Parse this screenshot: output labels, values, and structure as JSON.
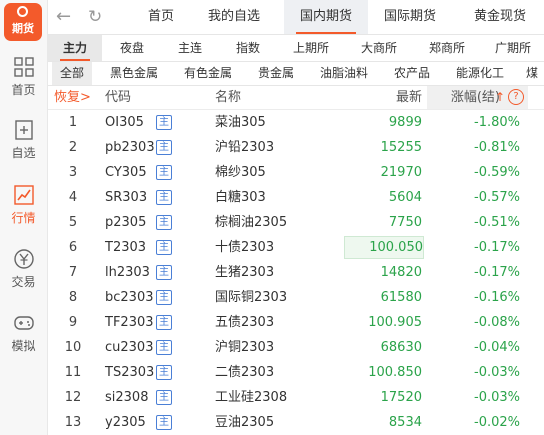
{
  "app": {
    "logo_text": "期货"
  },
  "sidebar": {
    "items": [
      {
        "label": "首页",
        "icon": "grid-icon",
        "active": false
      },
      {
        "label": "自选",
        "icon": "plus-square-icon",
        "active": false
      },
      {
        "label": "行情",
        "icon": "chart-icon",
        "active": true
      },
      {
        "label": "交易",
        "icon": "yen-icon",
        "active": false
      },
      {
        "label": "模拟",
        "icon": "gamepad-icon",
        "active": false
      }
    ]
  },
  "topnav": {
    "tabs": [
      {
        "label": "首页"
      },
      {
        "label": "我的自选"
      },
      {
        "label": "国内期货"
      },
      {
        "label": "国际期货"
      },
      {
        "label": "黄金现货"
      }
    ],
    "active_index": 2
  },
  "subtabs": {
    "tabs": [
      {
        "label": "主力"
      },
      {
        "label": "夜盘"
      },
      {
        "label": "主连"
      },
      {
        "label": "指数"
      },
      {
        "label": "上期所"
      },
      {
        "label": "大商所"
      },
      {
        "label": "郑商所"
      },
      {
        "label": "广期所"
      }
    ],
    "active_index": 0
  },
  "categories": {
    "tabs": [
      {
        "label": "全部"
      },
      {
        "label": "黑色金属"
      },
      {
        "label": "有色金属"
      },
      {
        "label": "贵金属"
      },
      {
        "label": "油脂油料"
      },
      {
        "label": "农产品"
      },
      {
        "label": "能源化工"
      },
      {
        "label": "煤"
      }
    ],
    "active_index": 0
  },
  "table": {
    "header": {
      "restore": "恢复>",
      "code": "代码",
      "name": "名称",
      "last": "最新",
      "change": "涨幅(结)",
      "sort_arrow": "↑",
      "help": "?"
    },
    "main_badge": "主",
    "rows": [
      {
        "idx": "1",
        "code": "OI305",
        "name": "菜油305",
        "last": "9899",
        "change": "-1.80%"
      },
      {
        "idx": "2",
        "code": "pb2303",
        "name": "沪铅2303",
        "last": "15255",
        "change": "-0.81%"
      },
      {
        "idx": "3",
        "code": "CY305",
        "name": "棉纱305",
        "last": "21970",
        "change": "-0.59%"
      },
      {
        "idx": "4",
        "code": "SR303",
        "name": "白糖303",
        "last": "5604",
        "change": "-0.57%"
      },
      {
        "idx": "5",
        "code": "p2305",
        "name": "棕榈油2305",
        "last": "7750",
        "change": "-0.51%"
      },
      {
        "idx": "6",
        "code": "T2303",
        "name": "十债2303",
        "last": "100.050",
        "change": "-0.17%",
        "highlight": true
      },
      {
        "idx": "7",
        "code": "lh2303",
        "name": "生猪2303",
        "last": "14820",
        "change": "-0.17%"
      },
      {
        "idx": "8",
        "code": "bc2303",
        "name": "国际铜2303",
        "last": "61580",
        "change": "-0.16%"
      },
      {
        "idx": "9",
        "code": "TF2303",
        "name": "五债2303",
        "last": "100.905",
        "change": "-0.08%"
      },
      {
        "idx": "10",
        "code": "cu2303",
        "name": "沪铜2303",
        "last": "68630",
        "change": "-0.04%"
      },
      {
        "idx": "11",
        "code": "TS2303",
        "name": "二债2303",
        "last": "100.850",
        "change": "-0.03%"
      },
      {
        "idx": "12",
        "code": "si2308",
        "name": "工业硅2308",
        "last": "17520",
        "change": "-0.03%"
      },
      {
        "idx": "13",
        "code": "y2305",
        "name": "豆油2305",
        "last": "8534",
        "change": "-0.02%"
      }
    ]
  },
  "colors": {
    "accent": "#f35a2b",
    "down": "#2ba34a",
    "badge": "#4a7fd6"
  }
}
